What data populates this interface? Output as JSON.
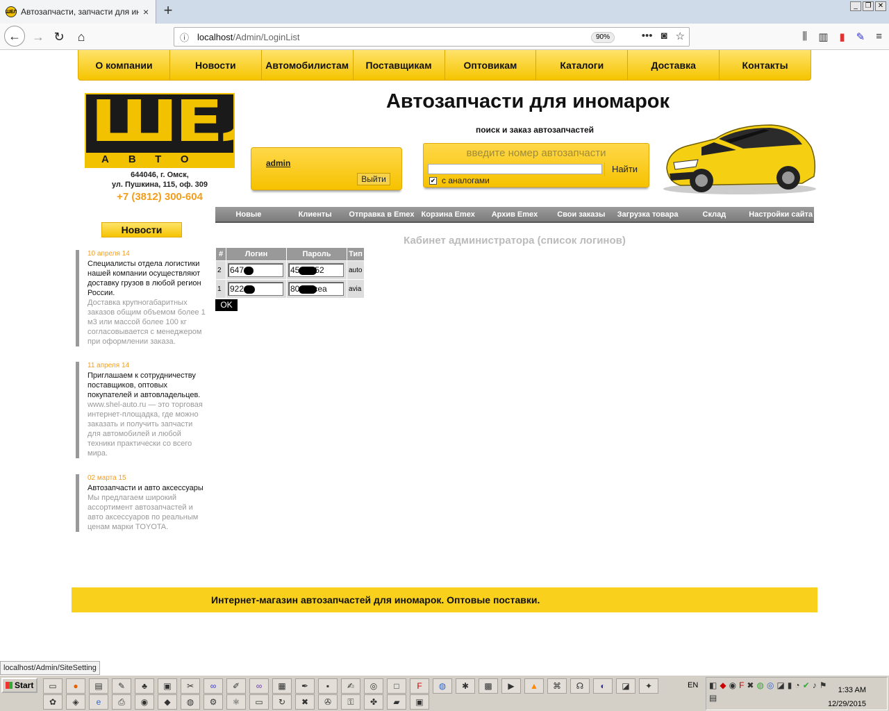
{
  "browser": {
    "tab_title": "Автозапчасти, запчасти для иномарок",
    "tab_close": "×",
    "newtab": "+",
    "url_host": "localhost",
    "url_path": "/Admin/LoginList",
    "zoom": "90%",
    "status_url": "localhost/Admin/SiteSetting",
    "icons": [
      "back-icon",
      "forward-icon",
      "reload-icon",
      "home-icon",
      "info-icon",
      "more-icon",
      "pocket-icon",
      "star-icon",
      "library-icon",
      "sidebar-icon"
    ]
  },
  "site": {
    "topmenu": [
      "О компании",
      "Новости",
      "Автомобилистам",
      "Поставщикам",
      "Оптовикам",
      "Каталоги",
      "Доставка",
      "Контакты"
    ],
    "logo_main": "ШЕЛ",
    "logo_sub": "АВТО",
    "address_line1": "644046, г. Омск,",
    "address_line2": "ул. Пушкина, 115, оф. 309",
    "phone": "+7 (3812) 300-604",
    "title": "Автозапчасти для иномарок",
    "subtitle": "поиск и заказ автозапчастей",
    "login_user": "admin",
    "logout_label": "Выйти",
    "search_placeholder": "введите номер автозапчасти",
    "search_button": "Найти",
    "analog_checked": true,
    "analog_label": "с аналогами",
    "adminmenu": [
      "Новые",
      "Клиенты",
      "Отправка в Emex",
      "Корзина Emex",
      "Архив Emex",
      "Свои заказы",
      "Загрузка товара",
      "Склад",
      "Настройки сайта"
    ],
    "news_button": "Новости",
    "news": [
      {
        "date": "10 апреля 14",
        "head": "Специалисты отдела логистики нашей компании осуществляют доставку грузов в любой регион России.",
        "body": "Доставка крупногабаритных заказов общим объемом более 1 м3 или массой более 100 кг согласовывается с менеджером при оформлении заказа."
      },
      {
        "date": "11 апреля 14",
        "head": "Приглашаем к сотрудничеству поставщиков, оптовых покупателей и автовладельцев.",
        "body": "www.shel-auto.ru — это торговая интернет-площадка, где можно заказать и получить запчасти для автомобилей и любой техники практически со всего мира."
      },
      {
        "date": "02 марта 15",
        "head": "Автозапчасти и авто аксессуары",
        "body": "Мы предлагаем широкий ассортимент автозапчастей и авто аксессуаров по реальным ценам марки TOYOTA."
      }
    ],
    "cabinet_title": "Кабинет администратора (список логинов)",
    "table": {
      "headers": [
        "#",
        "Логин",
        "Пароль",
        "Тип"
      ],
      "rows": [
        {
          "num": "2",
          "login": "647",
          "password_a": "45",
          "password_b": "52",
          "type": "auto"
        },
        {
          "num": "1",
          "login": "922",
          "password_a": "80",
          "password_b": "cea",
          "type": "avia"
        }
      ]
    },
    "ok_button": "OK",
    "footer": "Интернет-магазин автозапчастей для иномарок. Оптовые поставки."
  },
  "taskbar": {
    "start_label": "Start",
    "lang": "EN",
    "time": "1:33 AM",
    "date": "12/29/2015"
  }
}
